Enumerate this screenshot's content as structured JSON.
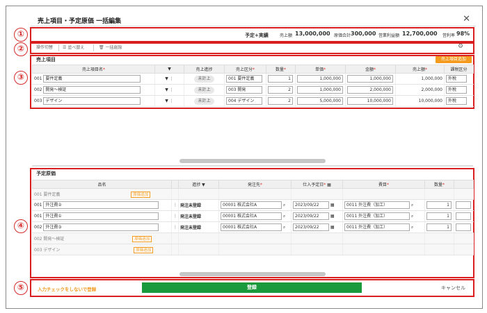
{
  "dialog": {
    "title": "売上項目・予定原価 一括編集",
    "close_label": "✕"
  },
  "markers": [
    "①",
    "②",
    "③",
    "④",
    "⑤"
  ],
  "summary": {
    "mode": "予定+実績",
    "sales_label": "売上額",
    "sales_value": "13,000,000",
    "cost_label": "原価合計",
    "cost_value": "300,000",
    "profit_label": "営業利益額",
    "profit_value": "12,700,000",
    "rate_label": "営利率",
    "rate_value": "98%"
  },
  "toolbar": {
    "switch_label": "操作切替",
    "sort_label": "並べ替え",
    "bulk_delete_label": "一括削除"
  },
  "sales": {
    "title": "売上項目",
    "add_button": "売上項目追加",
    "columns": [
      "売上項目名",
      "売上進捗",
      "売上区分",
      "数量",
      "単価",
      "金額",
      "売上額",
      "課税区分"
    ],
    "rows": [
      {
        "no": "001",
        "name": "要件定義",
        "status": "未計上",
        "category": "001 要件定義",
        "qty": "1",
        "price": "1,000,000",
        "amount": "1,000,000",
        "sales": "1,000,000",
        "tax": "外税"
      },
      {
        "no": "002",
        "name": "開発～検証",
        "status": "未計上",
        "category": "003 開発",
        "qty": "2",
        "price": "1,000,000",
        "amount": "2,000,000",
        "sales": "2,000,000",
        "tax": "外税"
      },
      {
        "no": "003",
        "name": "デザイン",
        "status": "未計上",
        "category": "004 デザイン",
        "qty": "2",
        "price": "5,000,000",
        "amount": "10,000,000",
        "sales": "10,000,000",
        "tax": "外税"
      }
    ]
  },
  "costs": {
    "title": "予定原価",
    "columns": [
      "品名",
      "進捗",
      "発注先",
      "仕入予定日",
      "費目",
      "数量"
    ],
    "add_cost_label": "原価追加",
    "groups": [
      {
        "label": "001 要件定義",
        "rows": [
          {
            "no": "001",
            "name": "外注費②",
            "status": "発注未登録",
            "vendor": "00001 株式会社A",
            "date": "2023/09/22",
            "item": "0011 外注費（加工）",
            "qty": "1"
          },
          {
            "no": "001",
            "name": "外注費①",
            "status": "発注未登録",
            "vendor": "00001 株式会社A",
            "date": "2023/09/22",
            "item": "0011 外注費（加工）",
            "qty": "1"
          },
          {
            "no": "002",
            "name": "外注費③",
            "status": "発注未登録",
            "vendor": "00001 株式会社A",
            "date": "2023/09/22",
            "item": "0011 外注費（加工）",
            "qty": "1"
          }
        ]
      },
      {
        "label": "002 開発～検証",
        "rows": []
      },
      {
        "label": "003 デザイン",
        "rows": []
      }
    ]
  },
  "footer": {
    "skip_check_label": "入力チェックをしないで登録",
    "register_label": "登録",
    "cancel_label": "キャンセル"
  },
  "colors": {
    "red": "#d81e1e",
    "orange": "#f39a1f",
    "green": "#1a9a3c"
  }
}
